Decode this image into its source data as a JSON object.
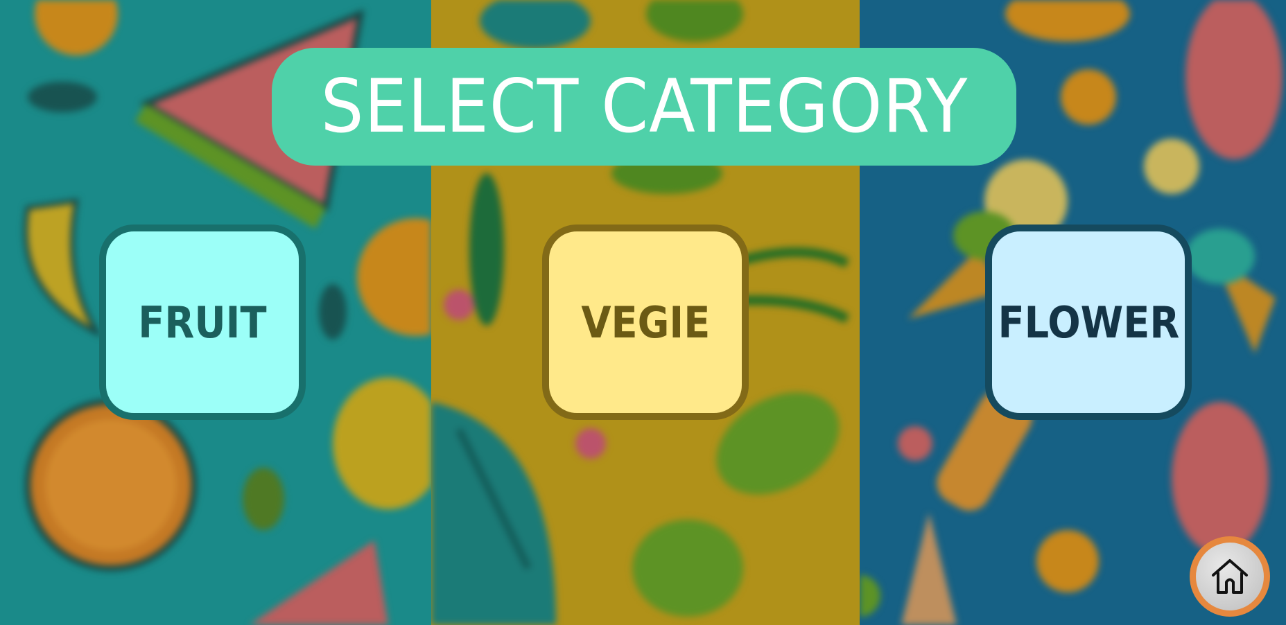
{
  "title": "SELECT CATEGORY",
  "categories": [
    {
      "id": "fruit",
      "label": "FRUIT"
    },
    {
      "id": "vegie",
      "label": "VEGIE"
    },
    {
      "id": "flower",
      "label": "FLOWER"
    }
  ],
  "icons": {
    "home": "home-icon"
  },
  "colors": {
    "title_bg": "#4fd1a9",
    "fruit_bg": "#9cfff8",
    "vegie_bg": "#ffe98a",
    "flower_bg": "#c9efff",
    "home_ring": "#e6883e"
  }
}
